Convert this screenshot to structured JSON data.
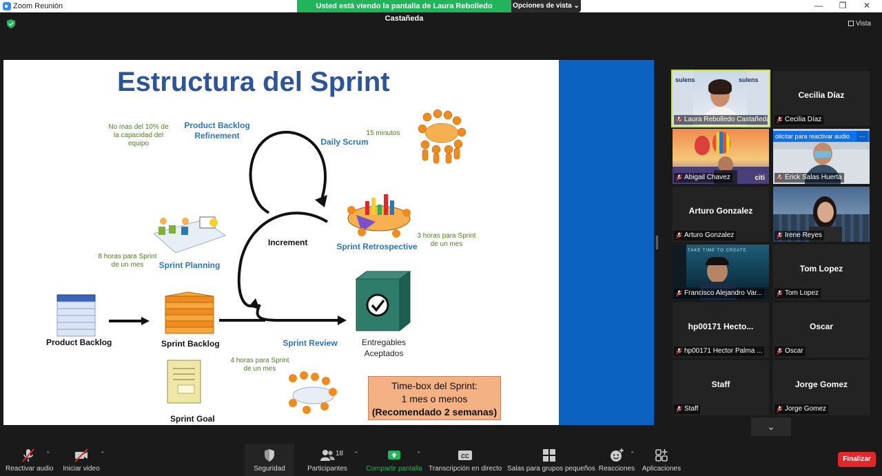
{
  "window": {
    "title": "Zoom Reunión",
    "share_banner": "Usted está viendo la pantalla de Laura Rebolledo Castañeda",
    "view_options": "Opciones de vista",
    "view_button": "Vista"
  },
  "slide": {
    "title": "Estructura del Sprint",
    "refinement_note": [
      "No mas del 10% de",
      "la capacidad del",
      "equipo"
    ],
    "product_backlog_refinement": [
      "Product Backlog",
      "Refinement"
    ],
    "daily_scrum_time": "15 minutos",
    "daily_scrum": "Daily Scrum",
    "increment": "Increment",
    "sprint_retrospective": "Sprint Retrospective",
    "retro_note": [
      "3 horas para Sprint",
      "de un mes"
    ],
    "planning_note": [
      "8 horas para Sprint",
      "de un mes"
    ],
    "sprint_planning": "Sprint Planning",
    "product_backlog": "Product Backlog",
    "sprint_backlog": "Sprint Backlog",
    "sprint_review": "Sprint Review",
    "deliverables": [
      "Entregables",
      "Aceptados"
    ],
    "review_note": [
      "4 horas para Sprint",
      "de un mes"
    ],
    "sprint_goal": "Sprint Goal",
    "timebox": [
      "Time-box del Sprint:",
      "1 mes o menos",
      "(Recomendado 2 semanas)"
    ]
  },
  "participants": [
    {
      "display_name": "",
      "label": "Laura Rebolledo Castañeda",
      "video": true,
      "active": true,
      "logo_text": "sulens"
    },
    {
      "display_name": "Cecilia Díaz",
      "label": "Cecilia Díaz",
      "video": false
    },
    {
      "display_name": "",
      "label": "Abigail Chavez",
      "video": true,
      "watermark": "citi"
    },
    {
      "display_name": "",
      "label": "Erick Salas Huerta",
      "video": true
    },
    {
      "display_name": "Arturo Gonzalez",
      "label": "Arturo Gonzalez",
      "video": false
    },
    {
      "display_name": "",
      "label": "Irene Reyes",
      "video": true
    },
    {
      "display_name": "",
      "label": "Francisco Alejandro Var...",
      "video": true,
      "banner_text": "TAKE TIME TO CREATE."
    },
    {
      "display_name": "Tom Lopez",
      "label": "Tom Lopez",
      "video": false
    },
    {
      "display_name": "hp00171   Hecto...",
      "label": "hp00171   Hector Palma ...",
      "video": false
    },
    {
      "display_name": "Oscar",
      "label": "Oscar",
      "video": false
    },
    {
      "display_name": "Staff",
      "label": "Staff",
      "video": false
    },
    {
      "display_name": "Jorge Gomez",
      "label": "Jorge Gomez",
      "video": false
    }
  ],
  "reactivate_audio_tooltip": "olicitar para reactivar audio",
  "toolbar": {
    "unmute": "Reactivar audio",
    "start_video": "Iniciar video",
    "security": "Seguridad",
    "participants": "Participantes",
    "participants_count": "18",
    "share_screen": "Compartir pantalla",
    "captions": "Transcripción en directo",
    "captions_icon": "CC",
    "breakout": "Salas para grupos pequeños",
    "reactions": "Reacciones",
    "apps": "Aplicaciones",
    "end": "Finalizar"
  },
  "colors": {
    "accent_green": "#23b35a",
    "slide_title": "#2f5597",
    "end_red": "#e02828",
    "active_speaker": "#c8e63a"
  }
}
